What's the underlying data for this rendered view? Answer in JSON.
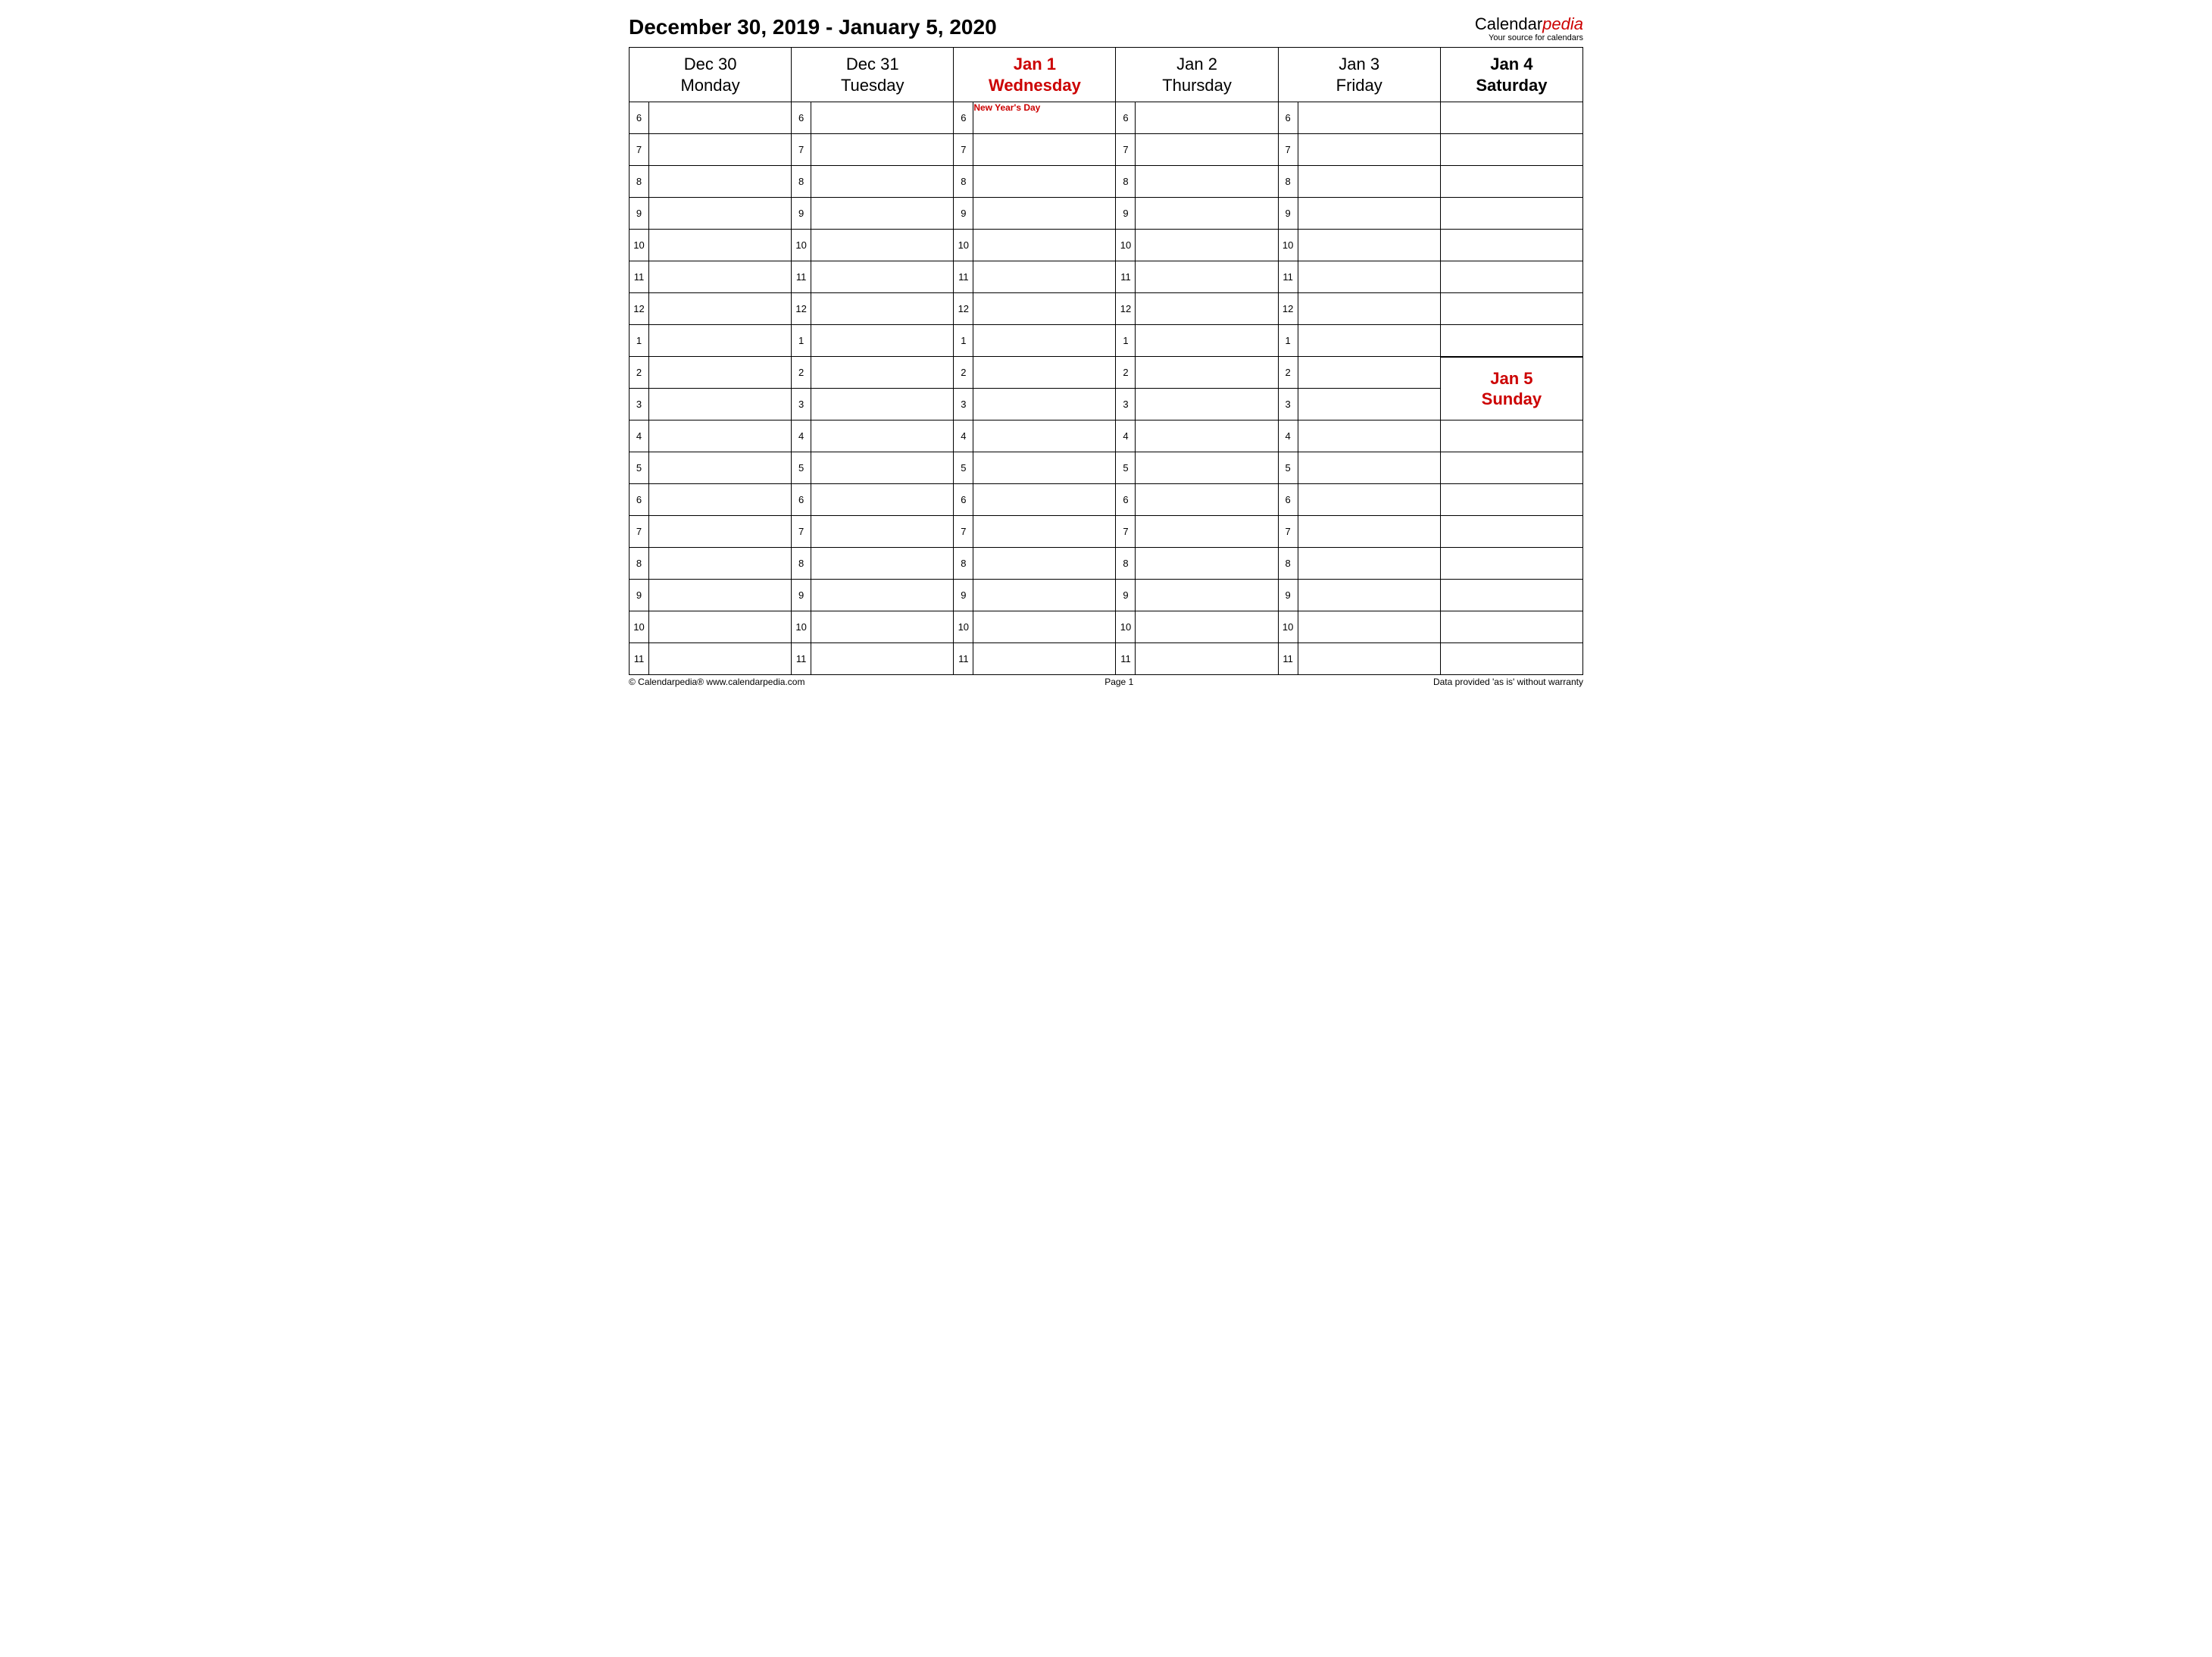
{
  "header": {
    "title": "December 30, 2019 - January 5, 2020",
    "brand_cal": "Calendar",
    "brand_pedia": "pedia",
    "brand_tag": "Your source for calendars"
  },
  "days": [
    {
      "date": "Dec 30",
      "weekday": "Monday",
      "style": "normal"
    },
    {
      "date": "Dec 31",
      "weekday": "Tuesday",
      "style": "normal"
    },
    {
      "date": "Jan 1",
      "weekday": "Wednesday",
      "style": "red",
      "event": "New Year's Day"
    },
    {
      "date": "Jan 2",
      "weekday": "Thursday",
      "style": "normal"
    },
    {
      "date": "Jan 3",
      "weekday": "Friday",
      "style": "normal"
    }
  ],
  "weekend": {
    "sat": {
      "date": "Jan 4",
      "weekday": "Saturday"
    },
    "sun": {
      "date": "Jan 5",
      "weekday": "Sunday"
    }
  },
  "hours": [
    "6",
    "7",
    "8",
    "9",
    "10",
    "11",
    "12",
    "1",
    "2",
    "3",
    "4",
    "5",
    "6",
    "7",
    "8",
    "9",
    "10",
    "11"
  ],
  "footer": {
    "left": "© Calendarpedia®   www.calendarpedia.com",
    "center": "Page 1",
    "right": "Data provided 'as is' without warranty"
  }
}
